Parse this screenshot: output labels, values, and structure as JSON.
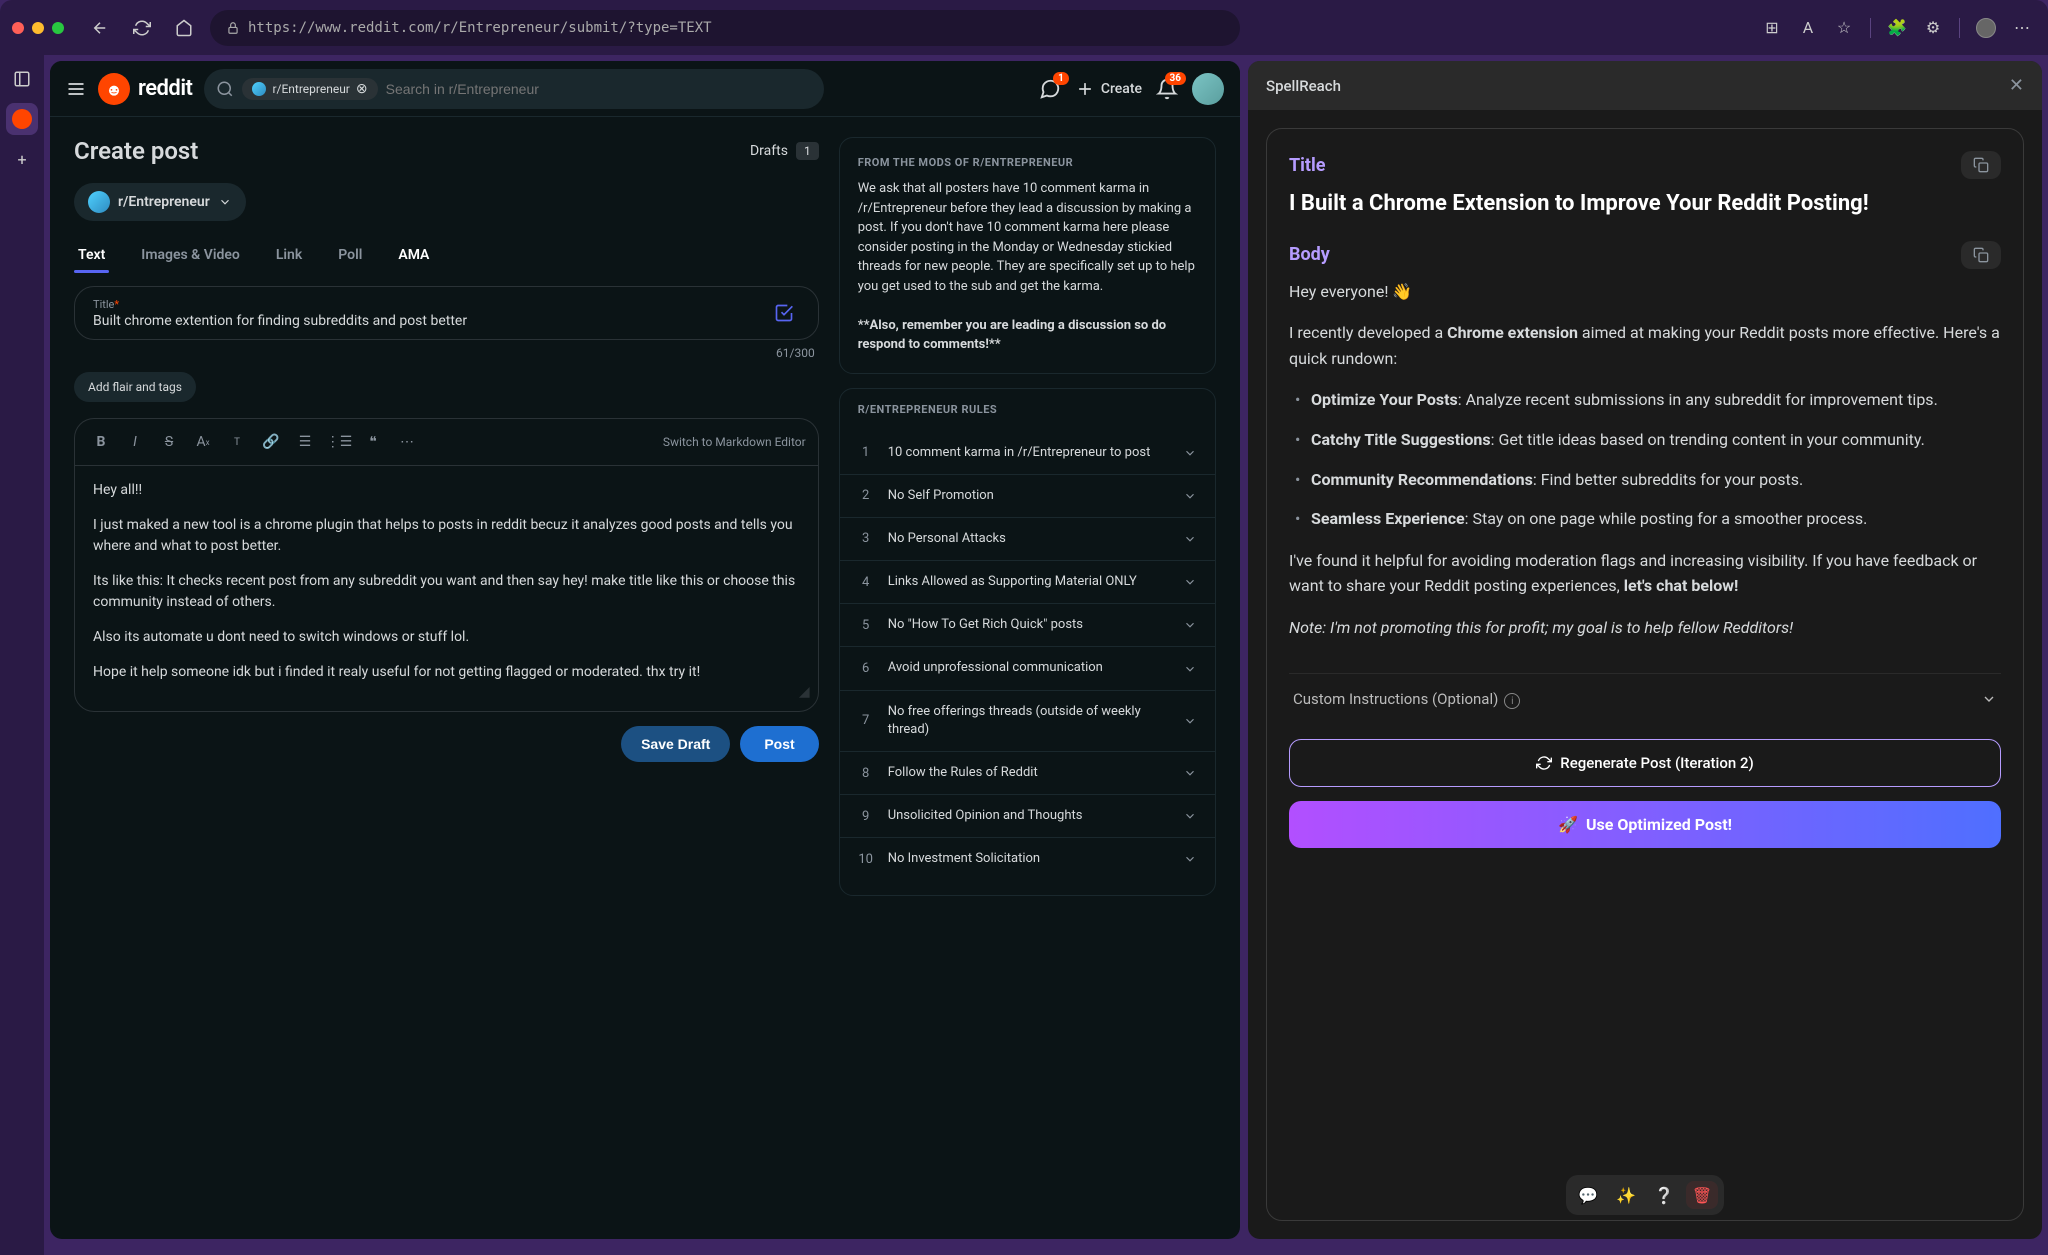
{
  "browser": {
    "url": "https://www.reddit.com/r/Entrepreneur/submit/?type=TEXT"
  },
  "reddit": {
    "logo_text": "reddit",
    "search": {
      "chip": "r/Entrepreneur",
      "placeholder": "Search in r/Entrepreneur"
    },
    "chat_badge": "1",
    "notif_badge": "36",
    "create_label": "Create"
  },
  "post": {
    "heading": "Create post",
    "drafts_label": "Drafts",
    "drafts_count": "1",
    "community": "r/Entrepreneur",
    "tabs": {
      "text": "Text",
      "images": "Images & Video",
      "link": "Link",
      "poll": "Poll",
      "ama": "AMA"
    },
    "title_label": "Title",
    "title_value": "Built chrome extention for finding subreddits and post better",
    "char_count": "61/300",
    "flair_label": "Add flair and tags",
    "markdown_switch": "Switch to Markdown Editor",
    "body_p1": "Hey all!!",
    "body_p2": "I just maked a new tool is a chrome plugin that helps to posts in reddit becuz it analyzes good posts and tells you where and what to post better.",
    "body_p3": "Its like this: It checks recent post from any subreddit you want and then say hey! make title like this or choose this community instead of others.",
    "body_p4": "Also its automate u dont need to switch windows or stuff lol.",
    "body_p5": "Hope it help someone idk but i finded it realy useful for not getting flagged or moderated. thx try it!",
    "save_draft": "Save Draft",
    "post_btn": "Post"
  },
  "mods": {
    "heading": "FROM THE MODS OF R/ENTREPRENEUR",
    "body": "We ask that all posters have 10 comment karma in /r/Entrepreneur before they lead a discussion by making a post. If you don't have 10 comment karma here please consider posting in the Monday or Wednesday stickied threads for new people. They are specifically set up to help you get used to the sub and get the karma.",
    "footer": "**Also, remember you are leading a discussion so do respond to comments!**"
  },
  "rules": {
    "heading": "R/ENTREPRENEUR RULES",
    "items": [
      "10 comment karma in /r/Entrepreneur to post",
      "No Self Promotion",
      "No Personal Attacks",
      "Links Allowed as Supporting Material ONLY",
      "No \"How To Get Rich Quick\" posts",
      "Avoid unprofessional communication",
      "No free offerings threads (outside of weekly thread)",
      "Follow the Rules of Reddit",
      "Unsolicited Opinion and Thoughts",
      "No Investment Solicitation"
    ]
  },
  "spellreach": {
    "brand": "SpellReach",
    "title_label": "Title",
    "body_label": "Body",
    "generated_title": "I Built a Chrome Extension to Improve Your Reddit Posting!",
    "body_greeting": "Hey everyone! 👋",
    "body_intro_a": "I recently developed a ",
    "body_intro_b": "Chrome extension",
    "body_intro_c": " aimed at making your Reddit posts more effective. Here's a quick rundown:",
    "bullet1_b": "Optimize Your Posts",
    "bullet1_t": ": Analyze recent submissions in any subreddit for improvement tips.",
    "bullet2_b": "Catchy Title Suggestions",
    "bullet2_t": ": Get title ideas based on trending content in your community.",
    "bullet3_b": "Community Recommendations",
    "bullet3_t": ": Find better subreddits for your posts.",
    "bullet4_b": "Seamless Experience",
    "bullet4_t": ": Stay on one page while posting for a smoother process.",
    "closing_a": "I've found it helpful for avoiding moderation flags and increasing visibility. If you have feedback or want to share your Reddit posting experiences, ",
    "closing_b": "let's chat below!",
    "note": "Note: I'm not promoting this for profit; my goal is to help fellow Redditors!",
    "custom_label": "Custom Instructions (Optional)",
    "regenerate": "Regenerate Post (Iteration 2)",
    "use": "Use Optimized Post!"
  }
}
